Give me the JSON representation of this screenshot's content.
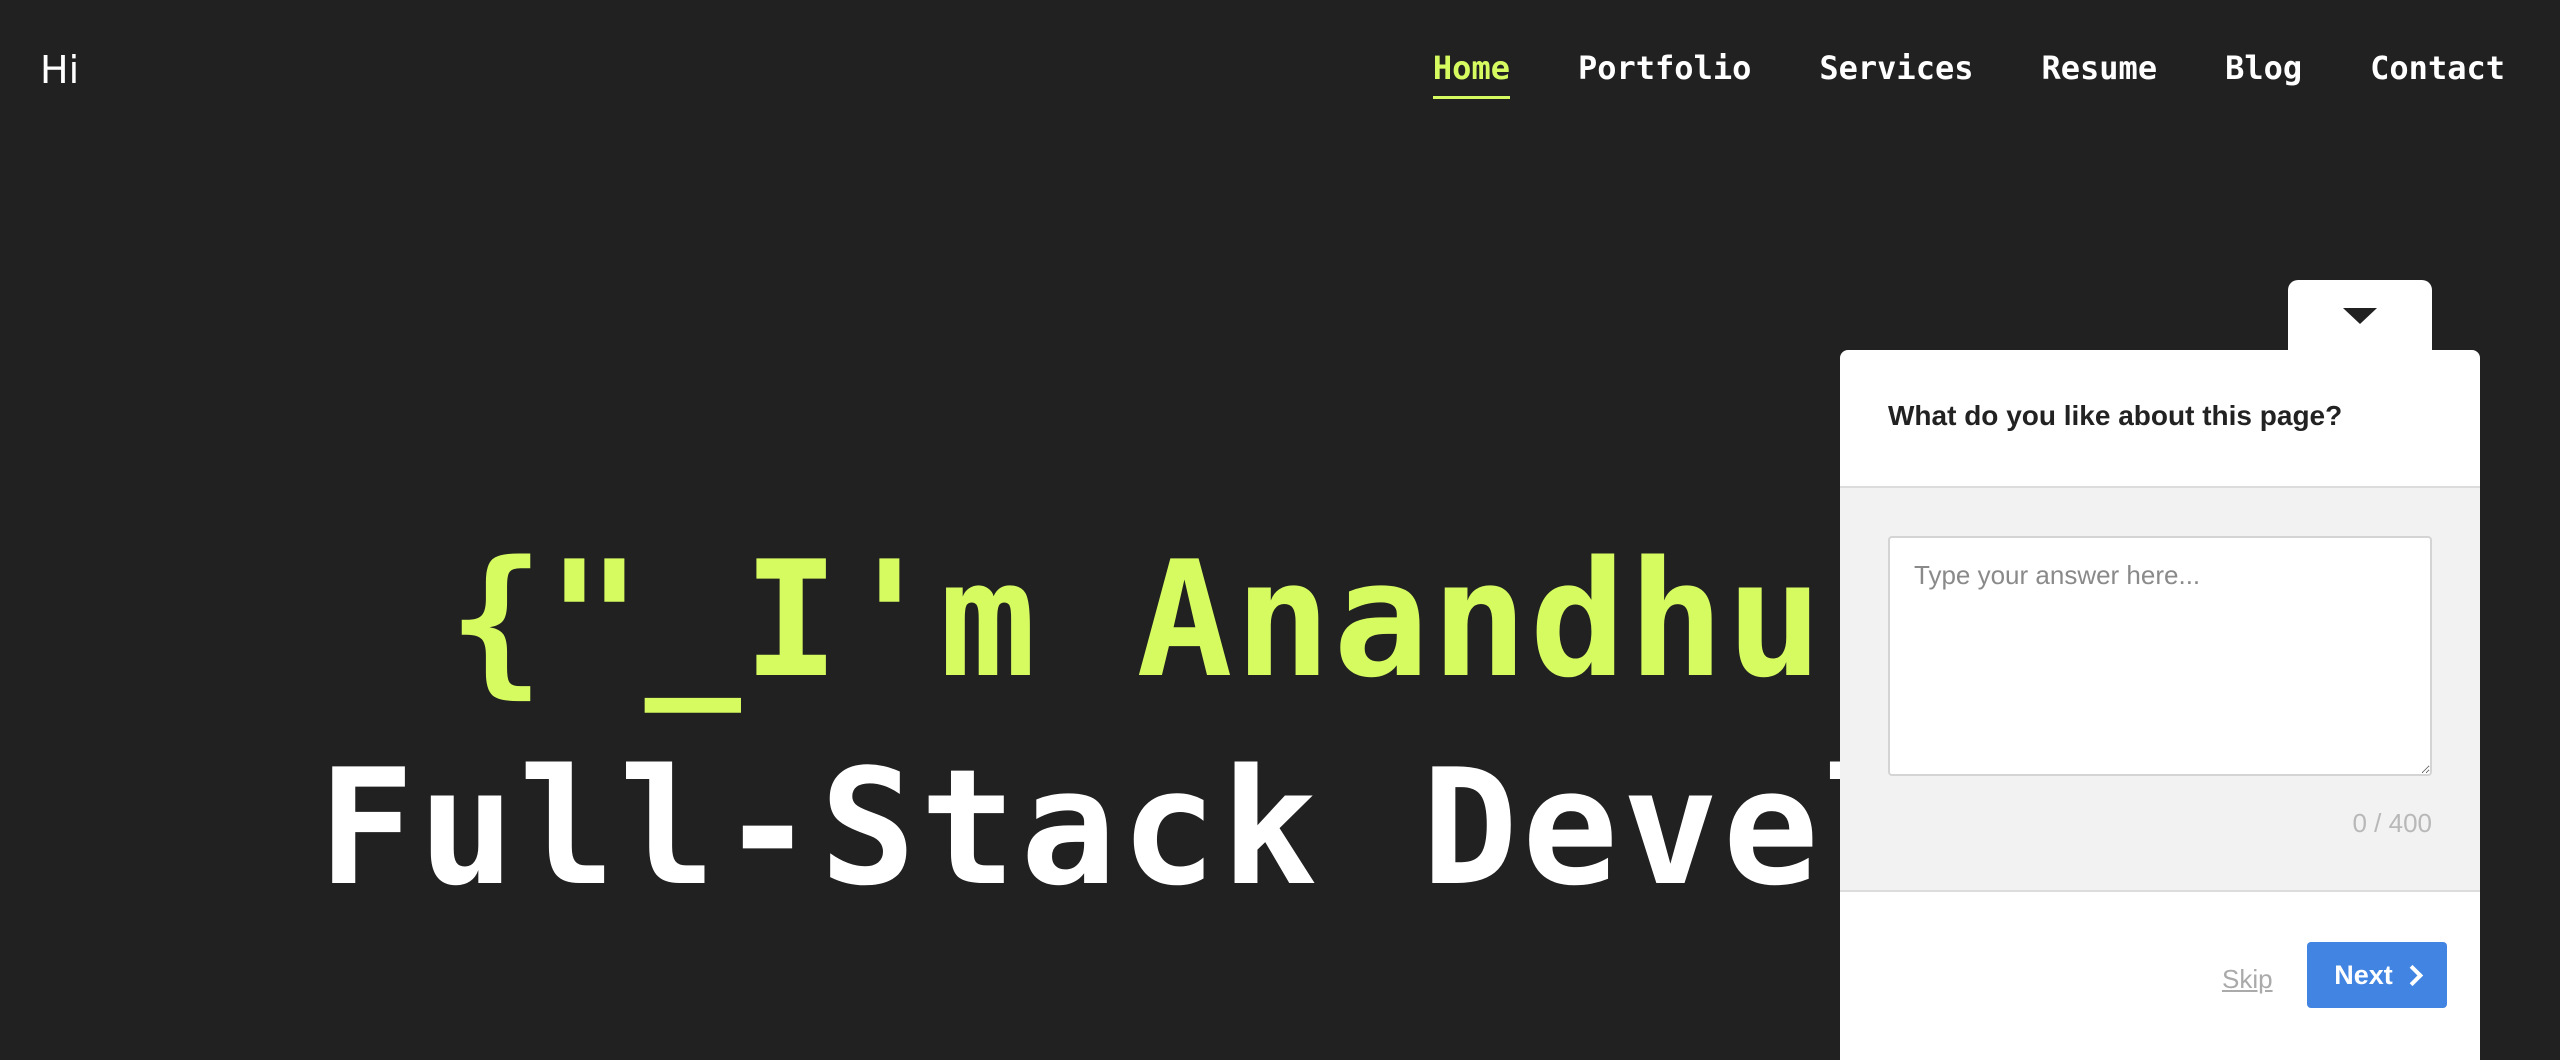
{
  "header": {
    "logo": "Hi",
    "nav": [
      {
        "label": "Home",
        "active": true
      },
      {
        "label": "Portfolio",
        "active": false
      },
      {
        "label": "Services",
        "active": false
      },
      {
        "label": "Resume",
        "active": false
      },
      {
        "label": "Blog",
        "active": false
      },
      {
        "label": "Contact",
        "active": false
      }
    ]
  },
  "hero": {
    "line1": "{\"_I'm Anandhu Sa",
    "line2": "Full-Stack Develop"
  },
  "survey": {
    "tab_icon": "caret-down-icon",
    "question": "What do you like about this page?",
    "placeholder": "Type your answer here...",
    "counter": "0 / 400",
    "skip_label": "Skip",
    "next_label": "Next",
    "next_icon": "chevron-right-icon"
  },
  "colors": {
    "background": "#212121",
    "accent": "#d6fb61",
    "button": "#4184e2"
  }
}
